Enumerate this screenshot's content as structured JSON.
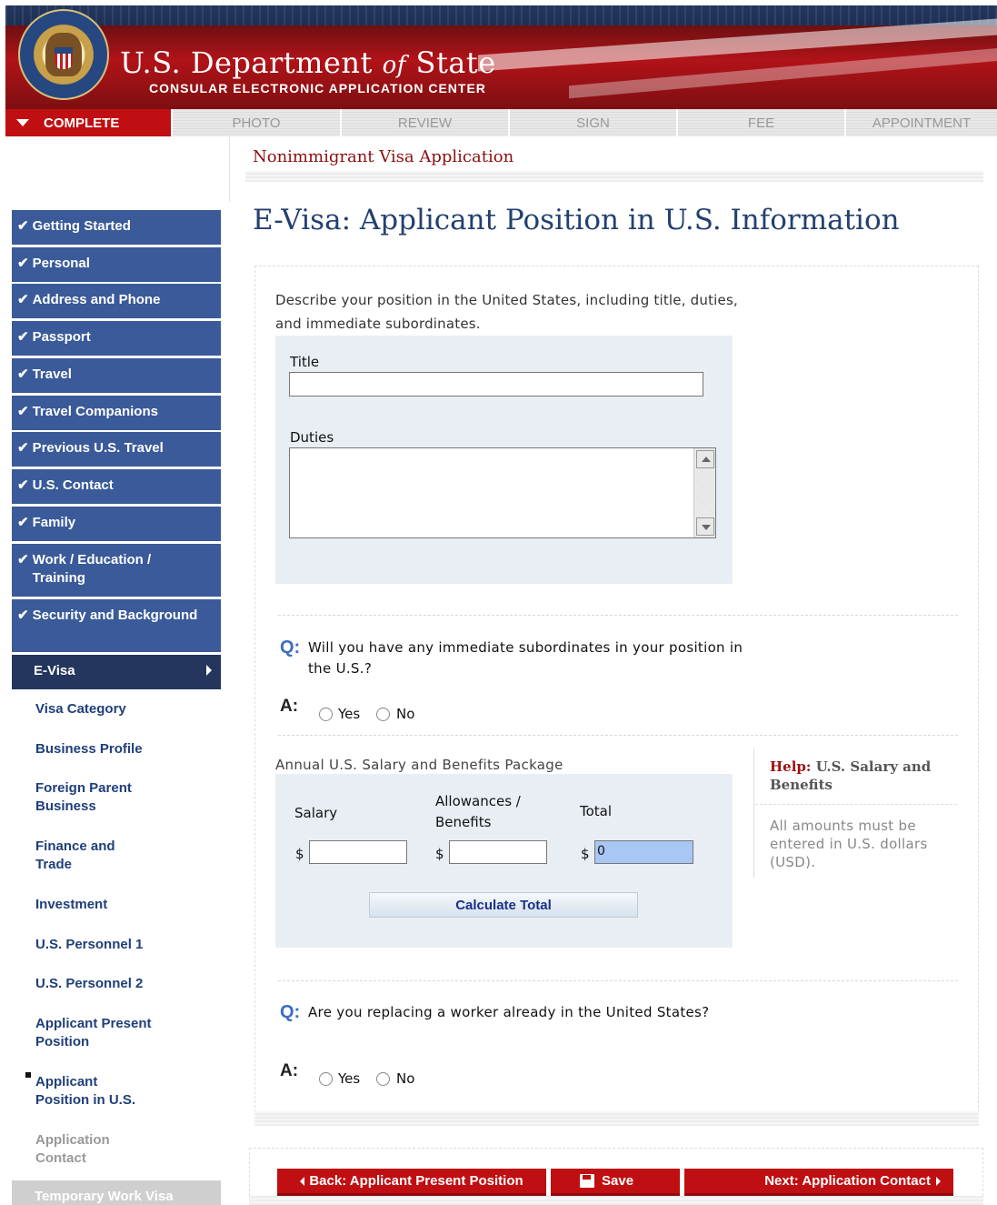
{
  "header": {
    "dept_name_a": "U.S. Department",
    "dept_name_of": "of",
    "dept_name_b": "State",
    "subtitle": "CONSULAR ELECTRONIC APPLICATION CENTER"
  },
  "tabs": [
    "COMPLETE",
    "PHOTO",
    "REVIEW",
    "SIGN",
    "FEE",
    "APPOINTMENT"
  ],
  "sidebar": {
    "completed": [
      "Getting Started",
      "Personal",
      "Address and Phone",
      "Passport",
      "Travel",
      "Travel Companions",
      "Previous U.S. Travel",
      "U.S. Contact",
      "Family",
      "Work / Education / Training",
      "Security and Background"
    ],
    "current_section": "E-Visa",
    "subitems": [
      "Visa Category",
      "Business Profile",
      "Foreign Parent Business",
      "Finance and Trade",
      "Investment",
      "U.S. Personnel 1",
      "U.S. Personnel 2",
      "Applicant Present Position",
      "Applicant Position in U.S.",
      "Application Contact"
    ],
    "next_section": "Temporary Work Visa"
  },
  "main": {
    "app_title": "Nonimmigrant Visa Application",
    "page_title": "E-Visa: Applicant Position in U.S. Information",
    "describe": "Describe your position in the United States, including title, duties, and immediate subordinates.",
    "title_label": "Title",
    "title_value": "",
    "duties_label": "Duties",
    "duties_value": "",
    "q1": {
      "q_marker": "Q:",
      "question": "Will you have any immediate subordinates in your position in the U.S.?",
      "a_marker": "A:",
      "yes": "Yes",
      "no": "No"
    },
    "salary": {
      "header": "Annual U.S. Salary and Benefits Package",
      "salary_label": "Salary",
      "allowances_label": "Allowances / Benefits",
      "total_label": "Total",
      "currency": "$",
      "salary_value": "",
      "allowances_value": "",
      "total_value": "0",
      "calc_button": "Calculate Total"
    },
    "help": {
      "prefix": "Help:",
      "title": "U.S. Salary and Benefits",
      "text": "All amounts must be entered in U.S. dollars (USD)."
    },
    "q2": {
      "q_marker": "Q:",
      "question": "Are you replacing a worker already in the United States?",
      "a_marker": "A:",
      "yes": "Yes",
      "no": "No"
    }
  },
  "buttons": {
    "back": "Back: Applicant Present Position",
    "save": "Save",
    "next": "Next: Application Contact"
  },
  "colors": {
    "brand_red": "#c00f12",
    "nav_blue": "#3a5a99",
    "nav_current": "#24365e",
    "link_blue": "#1f3f7a",
    "q_blue": "#3b6cc4"
  }
}
